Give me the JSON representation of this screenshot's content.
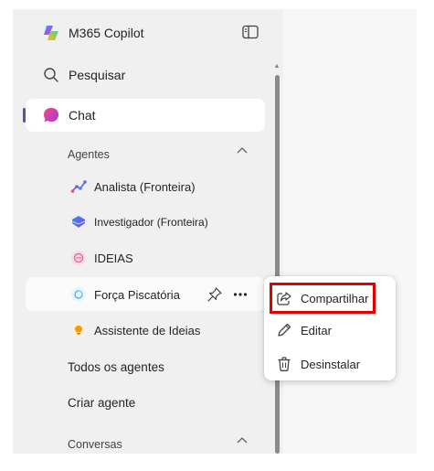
{
  "app": {
    "title": "M365 Copilot"
  },
  "nav": {
    "search_label": "Pesquisar",
    "chat_label": "Chat"
  },
  "agents_section": {
    "title": "Agentes",
    "items": [
      {
        "label": "Analista (Fronteira)",
        "icon": "analyst-icon"
      },
      {
        "label": "Investigador (Fronteira)",
        "icon": "researcher-icon"
      },
      {
        "label": "IDEIAS",
        "icon": "ideas-icon"
      },
      {
        "label": "Força Piscatória",
        "icon": "agent-icon"
      },
      {
        "label": "Assistente de Ideias",
        "icon": "lightbulb-icon"
      }
    ],
    "all_agents_label": "Todos os agentes",
    "create_agent_label": "Criar agente"
  },
  "conversations_section": {
    "title": "Conversas"
  },
  "context_menu": {
    "items": [
      {
        "label": "Compartilhar",
        "icon": "share-icon"
      },
      {
        "label": "Editar",
        "icon": "pencil-icon"
      },
      {
        "label": "Desinstalar",
        "icon": "trash-icon"
      }
    ]
  },
  "colors": {
    "accent": "#4f52b2",
    "highlight_border": "#e00000"
  }
}
